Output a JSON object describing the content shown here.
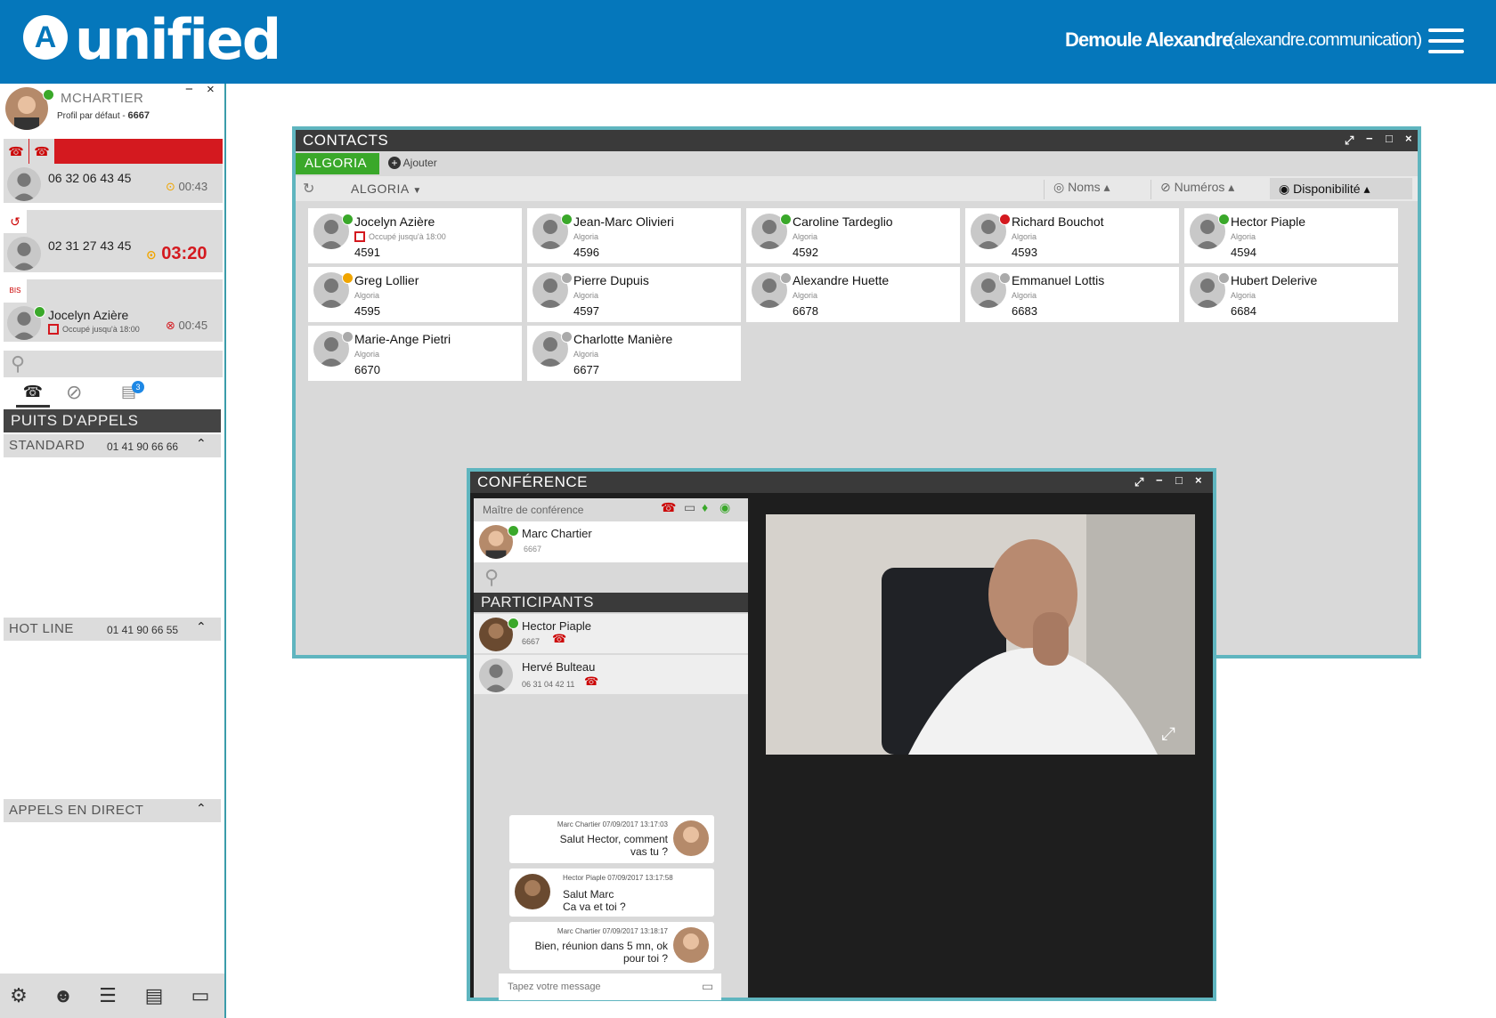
{
  "header": {
    "logo_symbol": "A",
    "logo": "unified",
    "user_name": "Demoule Alexandre",
    "user_login": "(alexandre.communication)"
  },
  "profile": {
    "name": "MCHARTIER",
    "profile_label": "Profil par défaut - ",
    "profile_ext": "6667",
    "min": "−",
    "close": "×"
  },
  "calls": [
    {
      "number": "06 32 06 43 45",
      "time": "00:43"
    },
    {
      "number": "02 31 27 43 45",
      "time": "03:20"
    },
    {
      "name": "Jocelyn Azière",
      "status": "Occupé jusqu'à 18:00",
      "time": "00:45"
    }
  ],
  "bis_label": "BIS",
  "tabs": {
    "badge": "3"
  },
  "puits": {
    "title": "PUITS D'APPELS",
    "groups": [
      {
        "name": "STANDARD",
        "number": "01 41 90 66 66"
      },
      {
        "name": "HOT LINE",
        "number": "01 41 90 66 55"
      },
      {
        "name": "APPELS EN DIRECT",
        "number": ""
      }
    ]
  },
  "contacts": {
    "title": "CONTACTS",
    "tab": "ALGORIA",
    "add": "Ajouter",
    "filter": "ALGORIA",
    "sort": [
      {
        "label": "Noms"
      },
      {
        "label": "Numéros"
      },
      {
        "label": "Disponibilité"
      }
    ],
    "items": [
      {
        "name": "Jocelyn Azière",
        "sub": "Occupé jusqu'à 18:00",
        "ext": "4591",
        "status": "green"
      },
      {
        "name": "Jean-Marc Olivieri",
        "sub": "Algoria",
        "ext": "4596",
        "status": "green"
      },
      {
        "name": "Caroline Tardeglio",
        "sub": "Algoria",
        "ext": "4592",
        "status": "green"
      },
      {
        "name": "Richard Bouchot",
        "sub": "Algoria",
        "ext": "4593",
        "status": "red"
      },
      {
        "name": "Hector Piaple",
        "sub": "Algoria",
        "ext": "4594",
        "status": "green"
      },
      {
        "name": "Greg Lollier",
        "sub": "Algoria",
        "ext": "4595",
        "status": "orange"
      },
      {
        "name": "Pierre Dupuis",
        "sub": "Algoria",
        "ext": "4597",
        "status": "grey"
      },
      {
        "name": "Alexandre Huette",
        "sub": "Algoria",
        "ext": "6678",
        "status": "grey"
      },
      {
        "name": "Emmanuel Lottis",
        "sub": "Algoria",
        "ext": "6683",
        "status": "grey"
      },
      {
        "name": "Hubert Delerive",
        "sub": "Algoria",
        "ext": "6684",
        "status": "grey"
      },
      {
        "name": "Marie-Ange Pietri",
        "sub": "Algoria",
        "ext": "6670",
        "status": "grey"
      },
      {
        "name": "Charlotte Manière",
        "sub": "Algoria",
        "ext": "6677",
        "status": "grey"
      }
    ]
  },
  "conference": {
    "title": "CONFÉRENCE",
    "master_label": "Maître de conférence",
    "master": {
      "name": "Marc Chartier",
      "ext": "6667"
    },
    "participants_title": "PARTICIPANTS",
    "participants": [
      {
        "name": "Hector Piaple",
        "ext": "6667"
      },
      {
        "name": "Hervé Bulteau",
        "ext": "06 31 04 42 11"
      }
    ],
    "messages": [
      {
        "meta": "Marc Chartier 07/09/2017 13:17:03",
        "l1": "Salut Hector, comment",
        "l2": "vas tu ?"
      },
      {
        "meta": "Hector Piaple 07/09/2017 13:17:58",
        "l1": "Salut Marc",
        "l2": "Ca va et toi ?"
      },
      {
        "meta": "Marc Chartier 07/09/2017 13:18:17",
        "l1": "Bien, réunion dans 5 mn, ok",
        "l2": "pour toi ?"
      }
    ],
    "input_placeholder": "Tapez votre message"
  }
}
